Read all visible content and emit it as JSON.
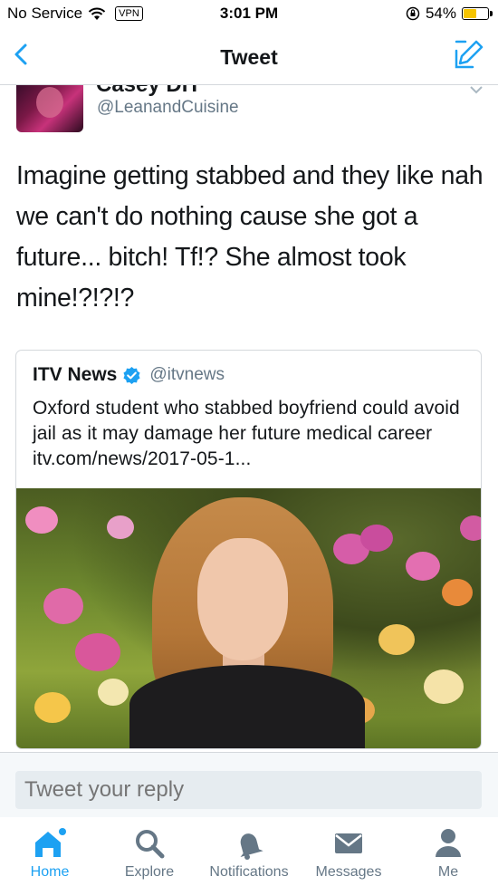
{
  "status_bar": {
    "carrier": "No Service",
    "vpn": "VPN",
    "time": "3:01 PM",
    "battery_percent": "54%",
    "battery_level": 0.54
  },
  "nav": {
    "title": "Tweet"
  },
  "tweet": {
    "display_name": "Casey DH",
    "handle": "@LeanandCuisine",
    "text": "Imagine getting stabbed and they like nah we can't do nothing cause she got a future... bitch! Tf!? She almost took mine!?!?!?"
  },
  "quoted_tweet": {
    "name": "ITV News",
    "handle": "@itvnews",
    "text": "Oxford student who stabbed boyfriend could avoid jail as it may damage her future medical career itv.com/news/2017-05-1..."
  },
  "reply": {
    "placeholder": "Tweet your reply"
  },
  "tabs": [
    {
      "label": "Home",
      "icon": "home-icon",
      "active": true
    },
    {
      "label": "Explore",
      "icon": "search-icon",
      "active": false
    },
    {
      "label": "Notifications",
      "icon": "bell-icon",
      "active": false
    },
    {
      "label": "Messages",
      "icon": "envelope-icon",
      "active": false
    },
    {
      "label": "Me",
      "icon": "person-icon",
      "active": false
    }
  ],
  "colors": {
    "accent": "#1da1f2",
    "secondary_text": "#657786",
    "battery": "#f5c400"
  }
}
